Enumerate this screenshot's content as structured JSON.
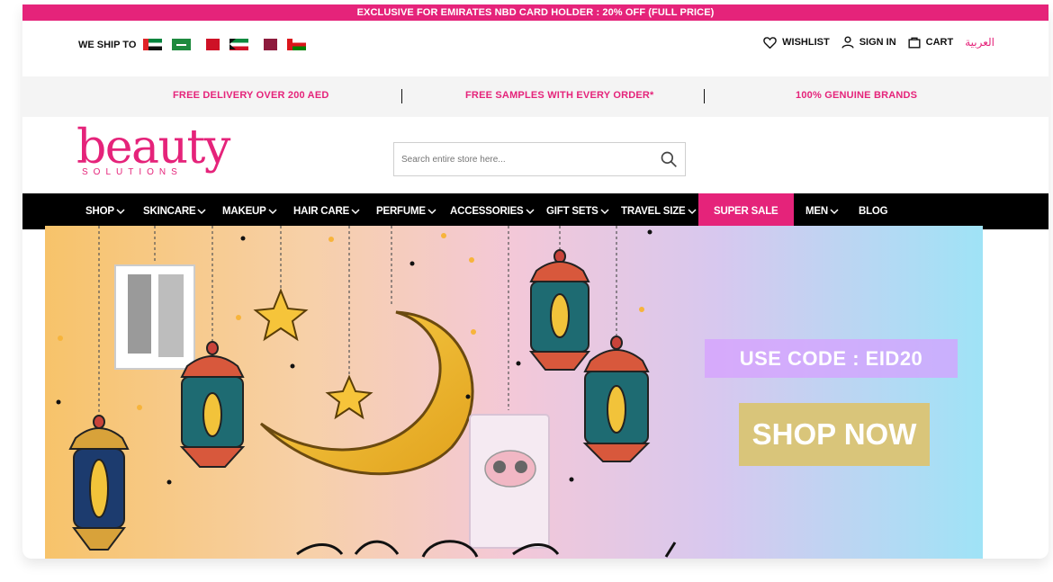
{
  "promo": {
    "text": "EXCLUSIVE FOR EMIRATES NBD CARD HOLDER : 20% OFF (FULL PRICE)"
  },
  "shipping": {
    "label": "WE SHIP TO"
  },
  "account": {
    "wishlist": "WISHLIST",
    "signin": "SIGN IN",
    "cart": "CART",
    "language": "العربية"
  },
  "benefits": [
    "FREE DELIVERY OVER 200 AED",
    "FREE SAMPLES WITH EVERY ORDER*",
    "100% GENUINE BRANDS"
  ],
  "logo": {
    "word": "beauty",
    "sub": "SOLUTIONS"
  },
  "search": {
    "placeholder": "Search entire store here..."
  },
  "nav": {
    "items": [
      {
        "label": "SHOP"
      },
      {
        "label": "SKINCARE"
      },
      {
        "label": "MAKEUP"
      },
      {
        "label": "HAIR CARE"
      },
      {
        "label": "PERFUME"
      },
      {
        "label": "ACCESSORIES"
      },
      {
        "label": "GIFT SETS"
      },
      {
        "label": "TRAVEL SIZE"
      },
      {
        "label": "SUPER SALE"
      },
      {
        "label": "MEN"
      },
      {
        "label": "BLOG"
      }
    ]
  },
  "banner": {
    "code": "USE CODE : EID20",
    "cta": "SHOP NOW"
  },
  "colors": {
    "brand_pink": "#e5237a",
    "nav_black": "#000000",
    "cta_gold": "#d9c57a"
  },
  "icons": [
    "uae-flag-icon",
    "saudi-flag-icon",
    "bahrain-flag-icon",
    "kuwait-flag-icon",
    "qatar-flag-icon",
    "oman-flag-icon",
    "heart-icon",
    "user-icon",
    "bag-icon",
    "search-icon",
    "chevron-down-icon"
  ]
}
